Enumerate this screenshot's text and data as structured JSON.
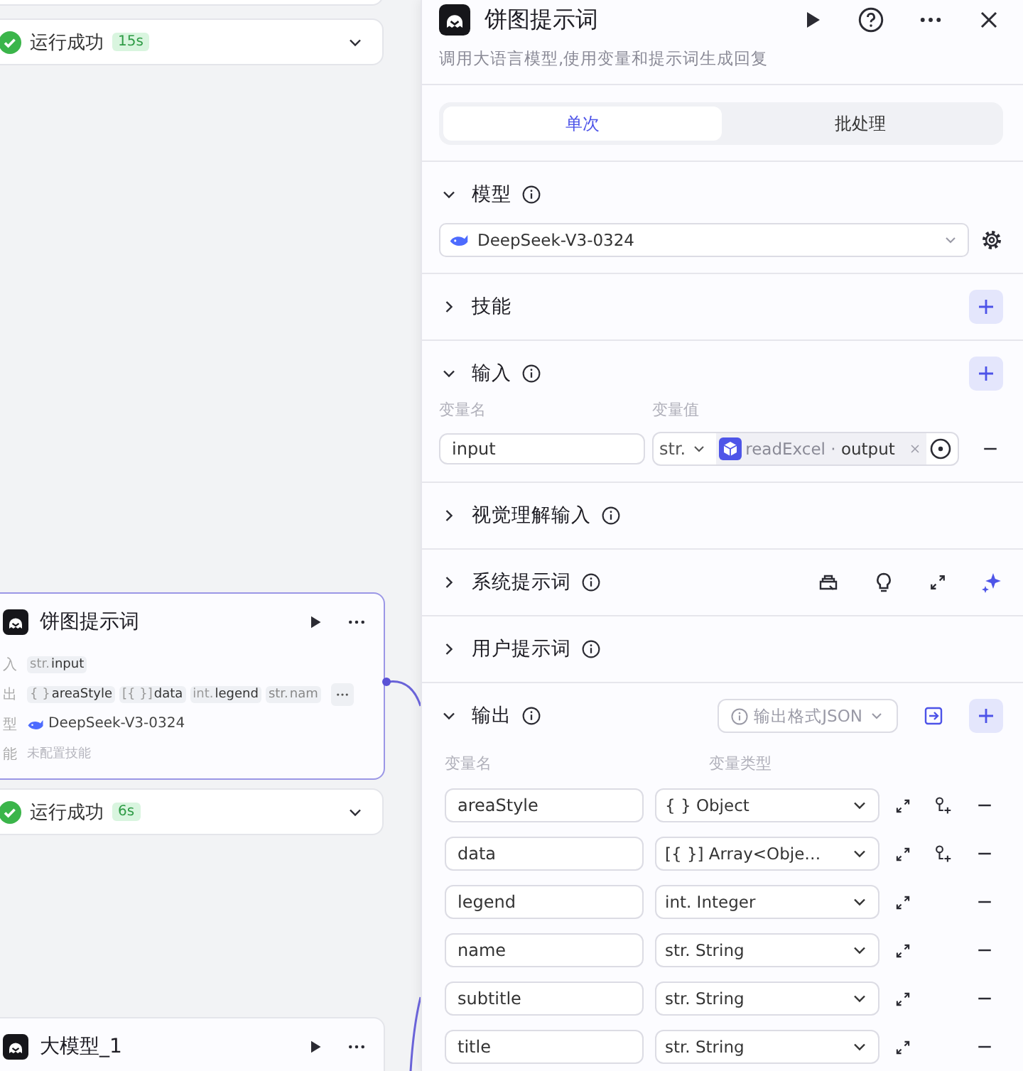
{
  "canvas": {
    "items": [
      {
        "kind": "status",
        "label": "运行成功",
        "duration": "15s"
      },
      {
        "kind": "node",
        "title": "饼图提示词",
        "selected": true,
        "rows": [
          {
            "label": "入",
            "kind": "tags",
            "tags": [
              {
                "type": "str.",
                "name": "input",
                "faded": false
              }
            ]
          },
          {
            "label": "出",
            "kind": "tags",
            "more": true,
            "tags": [
              {
                "type": "{ }",
                "name": "areaStyle",
                "faded": false
              },
              {
                "type": "[{ }]",
                "name": "data",
                "faded": false
              },
              {
                "type": "int.",
                "name": "legend",
                "faded": false
              },
              {
                "type": "str.",
                "name": "nam",
                "faded": true
              }
            ]
          },
          {
            "label": "型",
            "kind": "model",
            "text": "DeepSeek-V3-0324"
          },
          {
            "label": "能",
            "kind": "muted",
            "text": "未配置技能"
          }
        ]
      },
      {
        "kind": "status",
        "label": "运行成功",
        "duration": "6s"
      },
      {
        "kind": "node",
        "title": "大模型_1",
        "selected": false
      }
    ]
  },
  "panel": {
    "title": "饼图提示词",
    "description": "调用大语言模型,使用变量和提示词生成回复",
    "tabs": [
      {
        "label": "单次",
        "selected": true
      },
      {
        "label": "批处理",
        "selected": false
      }
    ],
    "sections": [
      {
        "kind": "model",
        "title": "模型",
        "expanded": true,
        "info": true,
        "add": false,
        "model": "DeepSeek-V3-0324"
      },
      {
        "kind": "plain",
        "title": "技能",
        "expanded": false,
        "info": false,
        "add": true
      },
      {
        "kind": "input",
        "title": "输入",
        "expanded": true,
        "info": true,
        "add": true,
        "columns": [
          "变量名",
          "变量值"
        ],
        "rows": [
          {
            "name": "input",
            "type": "str.",
            "reference": "readExcel · **output**"
          }
        ]
      },
      {
        "kind": "plain",
        "title": "视觉理解输入",
        "expanded": false,
        "info": true,
        "add": false
      },
      {
        "kind": "prompt",
        "title": "系统提示词",
        "expanded": false,
        "info": true,
        "add": false
      },
      {
        "kind": "plain",
        "title": "用户提示词",
        "expanded": false,
        "info": true,
        "add": false
      },
      {
        "kind": "output",
        "title": "输出",
        "expanded": true,
        "info": true,
        "add": true,
        "format": "输出格式JSON",
        "columns": [
          "变量名",
          "变量类型"
        ],
        "rows": [
          {
            "name": "areaStyle",
            "type": "{ } Object",
            "nested": true
          },
          {
            "name": "data",
            "type": "[{ }] Array<Obje…",
            "nested": true
          },
          {
            "name": "legend",
            "type": "int. Integer",
            "nested": false
          },
          {
            "name": "name",
            "type": "str. String",
            "nested": false
          },
          {
            "name": "subtitle",
            "type": "str. String",
            "nested": false
          },
          {
            "name": "title",
            "type": "str. String",
            "nested": false
          }
        ]
      }
    ]
  }
}
